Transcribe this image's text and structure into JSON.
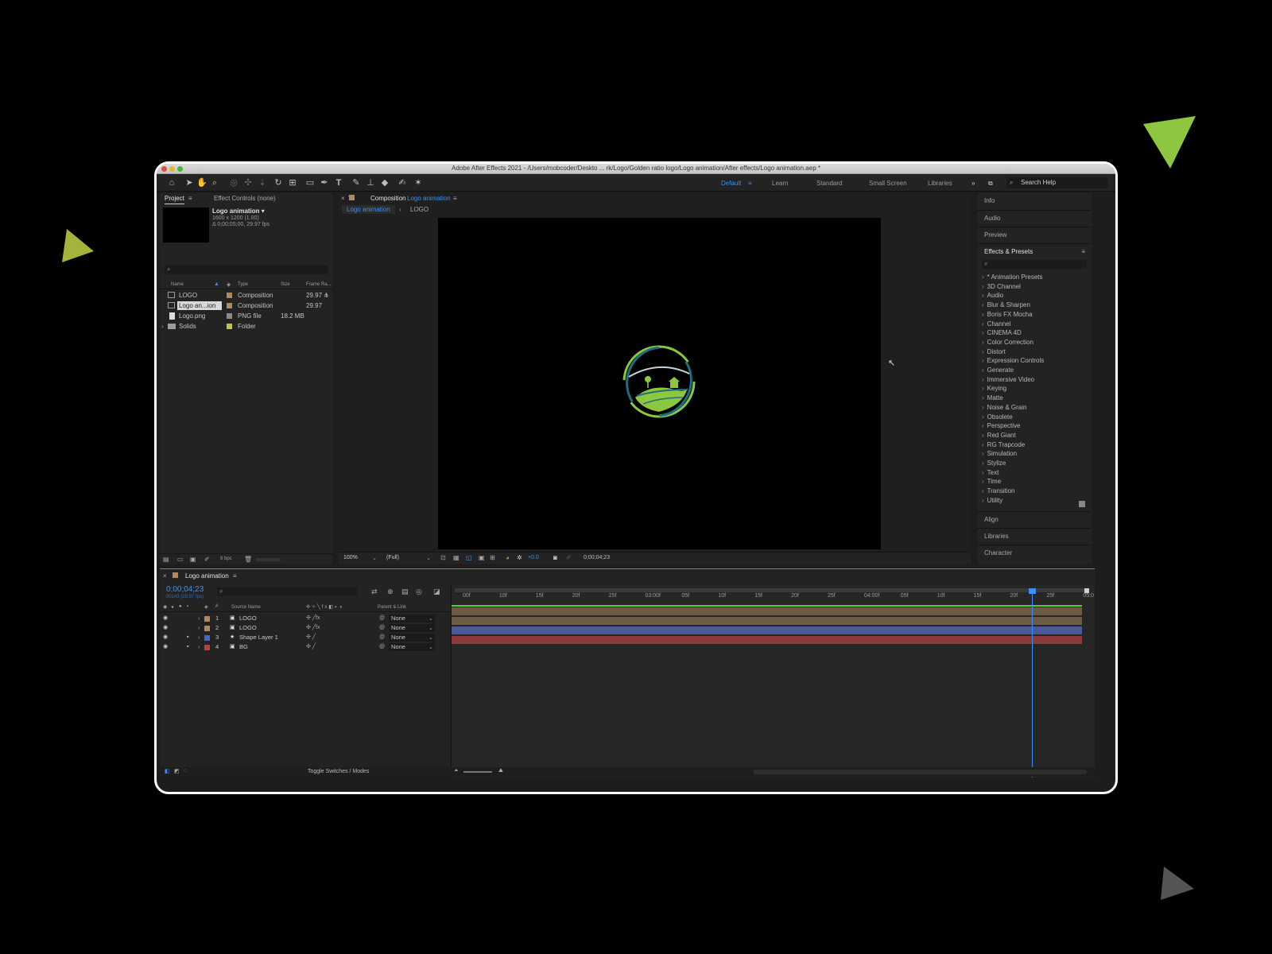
{
  "window": {
    "title": "Adobe After Effects 2021 - /Users/mobcoder/Deskto ... rk/Logo/Golden ratio logo/Logo animation/After effects/Logo animation.aep *"
  },
  "workspaces": [
    {
      "label": "Default",
      "active": true
    },
    {
      "label": "Learn",
      "active": false
    },
    {
      "label": "Standard",
      "active": false
    },
    {
      "label": "Small Screen",
      "active": false
    },
    {
      "label": "Libraries",
      "active": false
    }
  ],
  "search_help": {
    "placeholder": "Search Help"
  },
  "project_panel": {
    "tab_project": "Project",
    "tab_effect_controls": "Effect Controls (none)",
    "selected_name": "Logo animation ▾",
    "selected_dims": "1600 x 1200 (1.00)",
    "selected_duration": "Δ 0;00;05;00, 29.97 fps",
    "columns": [
      "Name",
      "Type",
      "Size",
      "Frame Ra..."
    ],
    "items": [
      {
        "name": "LOGO",
        "type": "Composition",
        "size": "",
        "fps": "29.97",
        "label_color": "#b08a5a"
      },
      {
        "name": "Logo an...ion",
        "type": "Composition",
        "size": "",
        "fps": "29.97",
        "label_color": "#b08a5a"
      },
      {
        "name": "Logo.png",
        "type": "PNG file",
        "size": "18.2 MB",
        "fps": "",
        "label_color": "#8c8c8c"
      },
      {
        "name": "Solids",
        "type": "Folder",
        "size": "",
        "fps": "",
        "label_color": "#c9c24a"
      }
    ],
    "bpc": "8 bpc"
  },
  "composition_panel": {
    "tab_prefix": "Composition",
    "tab_name": "Logo animation",
    "breadcrumb": [
      "Logo animation",
      "LOGO"
    ],
    "zoom": "100%",
    "resolution": "(Full)",
    "exposure": "+0.0",
    "timecode": "0;00;04;23"
  },
  "right_panels": {
    "top": [
      "Info",
      "Audio",
      "Preview"
    ],
    "effects_title": "Effects & Presets",
    "effects": [
      "* Animation Presets",
      "3D Channel",
      "Audio",
      "Blur & Sharpen",
      "Boris FX Mocha",
      "Channel",
      "CINEMA 4D",
      "Color Correction",
      "Distort",
      "Expression Controls",
      "Generate",
      "Immersive Video",
      "Keying",
      "Matte",
      "Noise & Grain",
      "Obsolete",
      "Perspective",
      "Red Giant",
      "RG Trapcode",
      "Simulation",
      "Stylize",
      "Text",
      "Time",
      "Transition",
      "Utility"
    ],
    "bottom": [
      "Align",
      "Libraries",
      "Character"
    ]
  },
  "timeline": {
    "tab": "Logo animation",
    "timecode": "0;00;04;23",
    "timecode_sub": "00143 (29.97 fps)",
    "col_source": "Source Name",
    "col_parent": "Parent & Link",
    "ruler": [
      "00f",
      "10f",
      "15f",
      "20f",
      "25f",
      "03:00f",
      "05f",
      "10f",
      "15f",
      "20f",
      "25f",
      "04:00f",
      "05f",
      "10f",
      "15f",
      "20f",
      "25f",
      "05:0"
    ],
    "layers": [
      {
        "num": "1",
        "name": "LOGO",
        "parent": "None",
        "color": "#b08a5a",
        "bar": "#6d5c45",
        "locked": false
      },
      {
        "num": "2",
        "name": "LOGO",
        "parent": "None",
        "color": "#b08a5a",
        "bar": "#6d5c45",
        "locked": false
      },
      {
        "num": "3",
        "name": "Shape Layer 1",
        "parent": "None",
        "color": "#4467c9",
        "bar": "#4a5a95",
        "locked": true
      },
      {
        "num": "4",
        "name": "BG",
        "parent": "None",
        "color": "#c43a3a",
        "bar": "#8e3a3a",
        "locked": true
      }
    ],
    "footer": "Toggle Switches / Modes",
    "playhead_fraction": 0.96
  },
  "colors": {
    "accent": "#3b8ff5",
    "logo_green": "#8dc63f",
    "logo_teal": "#1f6e80"
  },
  "icons": [
    "home-icon",
    "selection-icon",
    "hand-icon",
    "zoom-icon",
    "rotate-icon",
    "pen-icon",
    "type-icon",
    "brush-icon",
    "stamp-icon",
    "eraser-icon",
    "puppet-icon",
    "search-icon"
  ]
}
